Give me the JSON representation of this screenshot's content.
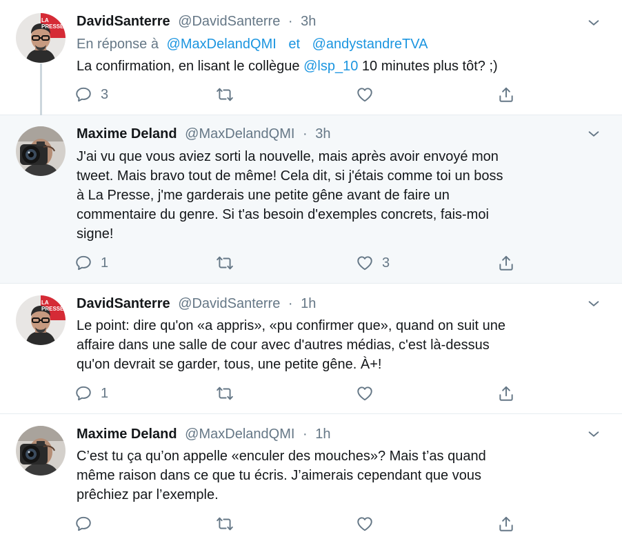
{
  "colors": {
    "link": "#1b95e0",
    "muted": "#657786",
    "highlight_bg": "#f5f8fa"
  },
  "tweets": [
    {
      "name": "DavidSanterre",
      "handle": "@DavidSanterre",
      "dot": "·",
      "time": "3h",
      "reply_prefix": "En réponse à",
      "reply_user1": "@MaxDelandQMI",
      "reply_and": "et",
      "reply_user2": "@andystandreTVA",
      "text_before": "La confirmation, en lisant le collègue",
      "mention": "@lsp_10",
      "text_after": "10 minutes plus tôt? ;)",
      "reply_count": "3",
      "retweet_count": "",
      "like_count": "",
      "avatar_logo": "LA PRESSE"
    },
    {
      "name": "Maxime Deland",
      "handle": "@MaxDelandQMI",
      "dot": "·",
      "time": "3h",
      "text_lines": [
        "J'ai vu que vous aviez sorti la nouvelle, mais après avoir envoyé mon",
        "tweet. Mais bravo tout de même! Cela dit, si j'étais comme toi un boss",
        "à La Presse, j'me garderais une petite gêne avant de faire un",
        "commentaire du genre. Si t'as besoin d'exemples concrets, fais-moi",
        "signe!"
      ],
      "reply_count": "1",
      "retweet_count": "",
      "like_count": "3"
    },
    {
      "name": "DavidSanterre",
      "handle": "@DavidSanterre",
      "dot": "·",
      "time": "1h",
      "text_lines": [
        "Le point: dire qu'on «a appris», «pu confirmer que», quand on suit une",
        "affaire dans une salle de cour avec d'autres médias, c'est là-dessus",
        "qu'on devrait se garder, tous, une petite gêne. À+!"
      ],
      "reply_count": "1",
      "retweet_count": "",
      "like_count": "",
      "avatar_logo": "LA PRESSE"
    },
    {
      "name": "Maxime Deland",
      "handle": "@MaxDelandQMI",
      "dot": "·",
      "time": "1h",
      "text_lines": [
        "C’est tu ça qu’on appelle «enculer des mouches»? Mais t’as quand",
        "même raison dans ce que tu écris. J’aimerais cependant que vous",
        "prêchiez par l’exemple."
      ],
      "reply_count": "",
      "retweet_count": "",
      "like_count": ""
    }
  ]
}
